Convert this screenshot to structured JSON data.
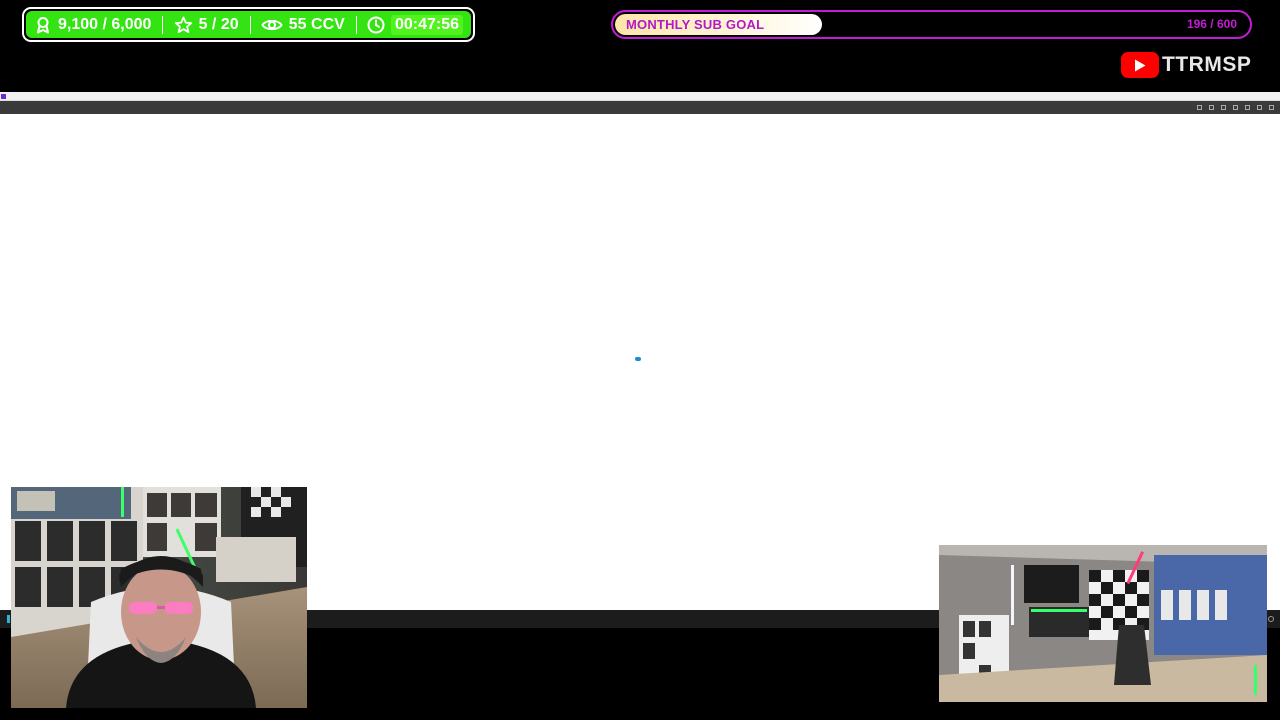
{
  "stats": {
    "followers": "9,100 / 6,000",
    "rating": "5 / 20",
    "viewers": "55 CCV",
    "uptime": "00:47:56",
    "bar_color": "#33e412"
  },
  "sub_goal": {
    "label": "MONTHLY SUB GOAL",
    "count": "196 / 600",
    "progress": 0.327,
    "accent": "#c41cd6"
  },
  "youtube": {
    "handle": "TTRMSP",
    "logo_color": "#ff0000"
  },
  "remote_window": {
    "title": "",
    "toolbar_items": [],
    "status_text": "",
    "cancel_text": "",
    "spinner_color": "#1a8fc9"
  },
  "webcams": {
    "main": "streamer-webcam",
    "room": "room-camera"
  }
}
